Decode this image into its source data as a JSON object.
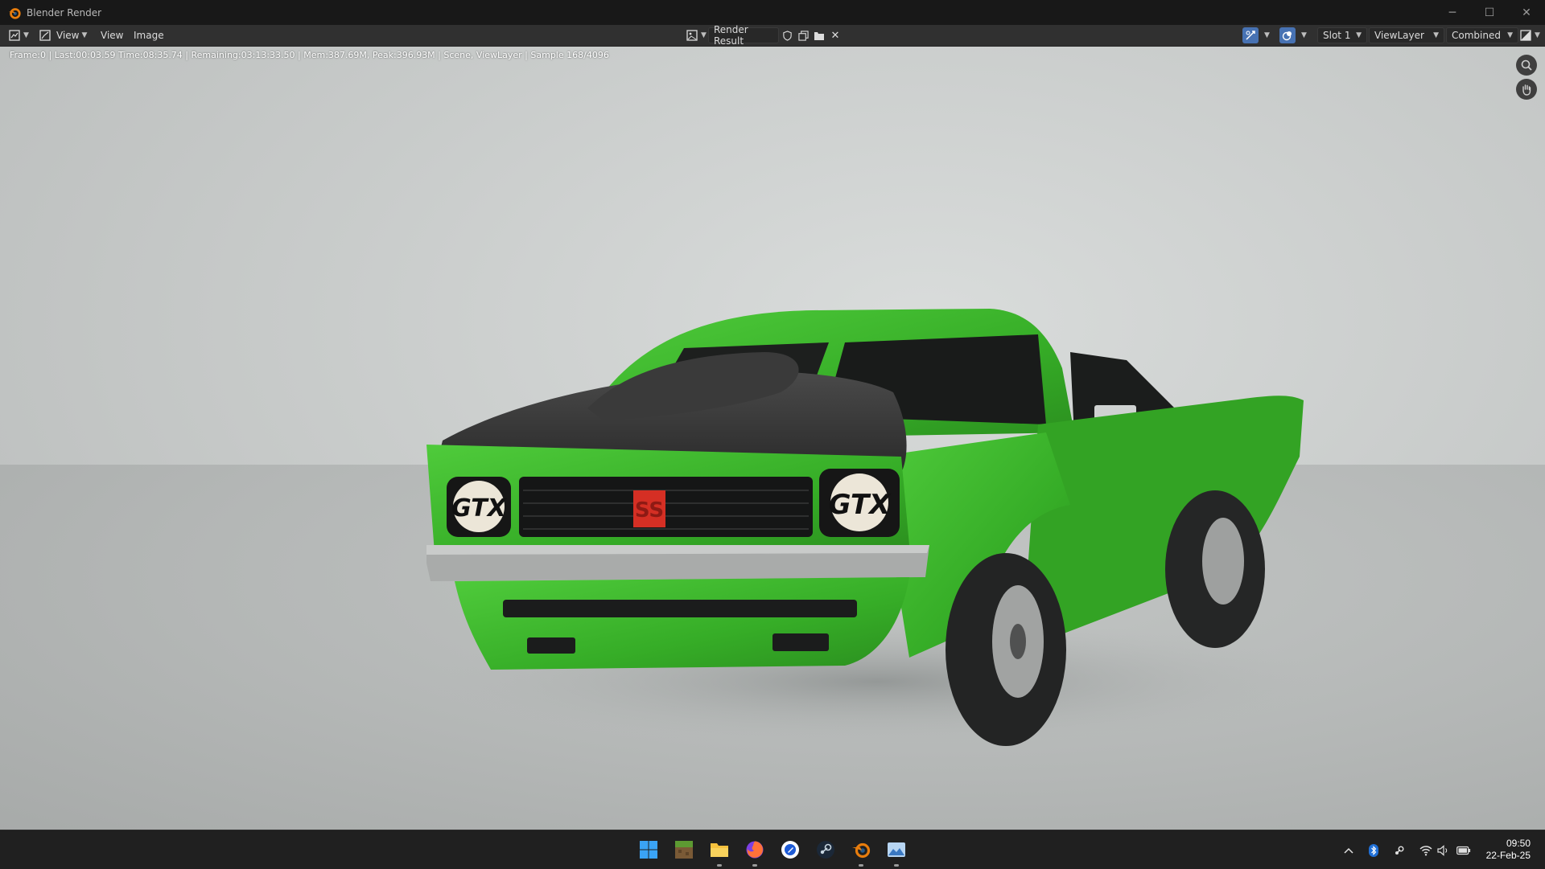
{
  "window": {
    "title": "Blender Render",
    "controls": {
      "minimize": "─",
      "maximize": "☐",
      "close": "✕"
    }
  },
  "header": {
    "menus": {
      "view1": "View",
      "view2": "View",
      "image": "Image"
    },
    "image_name": "Render Result",
    "slot": "Slot 1",
    "view_layer": "ViewLayer",
    "pass": "Combined"
  },
  "viewport": {
    "status": "Frame:0 | Last:00:03.59 Time:08:35.74 | Remaining:03:13:33.50 | Mem:387.69M, Peak:396.93M | Scene, ViewLayer | Sample 168/4096",
    "headlight_text": "GTX",
    "grille_badge": "SS"
  },
  "taskbar": {
    "apps": [
      "start",
      "minecraft",
      "file-explorer",
      "firefox",
      "pen-app",
      "steam",
      "blender",
      "photos"
    ],
    "clock_time": "09:50",
    "clock_date": "22-Feb-25"
  },
  "colors": {
    "car_body": "#3bb52b",
    "accent_blue": "#4772b3",
    "blender_orange": "#e87d0d"
  }
}
